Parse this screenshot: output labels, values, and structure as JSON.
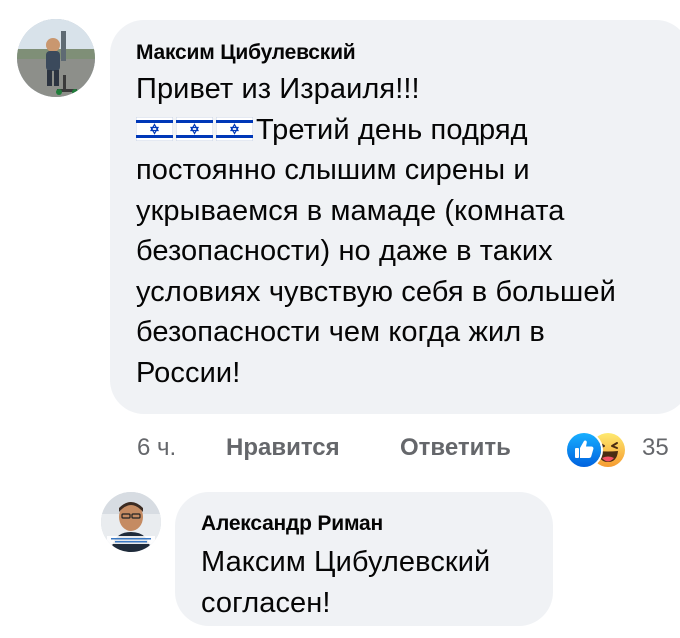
{
  "comment": {
    "author": "Максим Цибулевский",
    "text_lines": [
      "Привет из Израиля!!!",
      "Третий день подряд",
      "постоянно слышим сирены и",
      "укрываемся в мамаде (комната",
      "безопасности) но даже в таких",
      "условиях чувствую себя в большей",
      "безопасности чем когда жил в",
      "России!"
    ],
    "flag_count": 3,
    "time": "6 ч.",
    "like_label": "Нравится",
    "reply_label": "Ответить",
    "reactions": [
      "like-icon",
      "haha-icon"
    ],
    "reaction_count": "35"
  },
  "reply": {
    "author": "Александр Риман",
    "text_lines": [
      "Максим Цибулевский",
      "согласен!"
    ]
  },
  "colors": {
    "bubble_bg": "#f0f2f5",
    "secondary_text": "#65676b",
    "like_blue": "#1877f2",
    "haha_yellow": "#f7b125"
  }
}
